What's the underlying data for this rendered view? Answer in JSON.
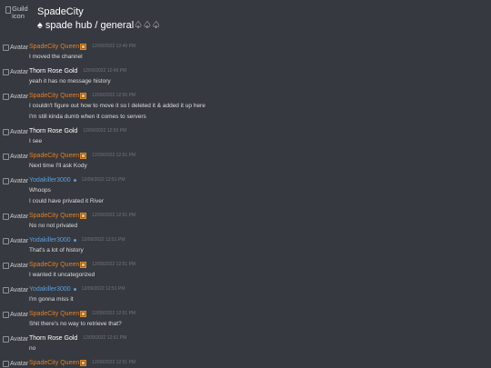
{
  "header": {
    "guild_icon_alt": "Guild icon",
    "guild_name": "SpadeCity",
    "channel_name": "♠ spade hub / general♤♤♤"
  },
  "colors": {
    "background": "#36393f",
    "queen": "#e67e22",
    "yodakiller": "#5b9fde",
    "thorn": "#ffffff"
  },
  "messages": [
    {
      "avatar_alt": "Avatar",
      "author": "SpadeCity Queen",
      "color": "#e67e22",
      "badge": "crown",
      "time": "12/09/2022 12:49 PM",
      "lines": [
        "I moved the channel"
      ]
    },
    {
      "avatar_alt": "Avatar",
      "author": "Thorn Rose Gold",
      "color": "#ffffff",
      "time": "12/09/2022 12:49 PM",
      "lines": [
        "yeah it has no message history"
      ]
    },
    {
      "avatar_alt": "Avatar",
      "author": "SpadeCity Queen",
      "color": "#e67e22",
      "badge": "crown",
      "time": "12/09/2022 12:50 PM",
      "lines": [
        "I couldn't figure out how to move it so I deleted it & added it up here",
        "I'm still kinda dumb when it comes to servers"
      ]
    },
    {
      "avatar_alt": "Avatar",
      "author": "Thorn Rose Gold",
      "color": "#ffffff",
      "time": "12/09/2022 12:50 PM",
      "lines": [
        "I see"
      ]
    },
    {
      "avatar_alt": "Avatar",
      "author": "SpadeCity Queen",
      "color": "#e67e22",
      "badge": "crown",
      "time": "12/09/2022 12:51 PM",
      "lines": [
        "Next time I'll ask Kody"
      ]
    },
    {
      "avatar_alt": "Avatar",
      "author": "Yodakiller3000",
      "color": "#5b9fde",
      "badge": "dot",
      "time": "12/09/2022 12:51 PM",
      "lines": [
        "Whoops",
        "I could have privated it River"
      ]
    },
    {
      "avatar_alt": "Avatar",
      "author": "SpadeCity Queen",
      "color": "#e67e22",
      "badge": "crown",
      "time": "12/09/2022 12:51 PM",
      "lines": [
        "No no not privated"
      ]
    },
    {
      "avatar_alt": "Avatar",
      "author": "Yodakiller3000",
      "color": "#5b9fde",
      "badge": "dot",
      "time": "12/09/2022 12:51 PM",
      "lines": [
        "That's a lot of history"
      ]
    },
    {
      "avatar_alt": "Avatar",
      "author": "SpadeCity Queen",
      "color": "#e67e22",
      "badge": "crown",
      "time": "12/09/2022 12:51 PM",
      "lines": [
        "I wanted it uncategorized"
      ]
    },
    {
      "avatar_alt": "Avatar",
      "author": "Yodakiller3000",
      "color": "#5b9fde",
      "badge": "dot",
      "time": "12/09/2022 12:51 PM",
      "lines": [
        "I'm gonna miss it"
      ]
    },
    {
      "avatar_alt": "Avatar",
      "author": "SpadeCity Queen",
      "color": "#e67e22",
      "badge": "crown",
      "time": "12/09/2022 12:51 PM",
      "lines": [
        "Shit there's no way to retrieve that?"
      ]
    },
    {
      "avatar_alt": "Avatar",
      "author": "Thorn Rose Gold",
      "color": "#ffffff",
      "time": "12/09/2022 12:51 PM",
      "lines": [
        "no"
      ]
    },
    {
      "avatar_alt": "Avatar",
      "author": "SpadeCity Queen",
      "color": "#e67e22",
      "badge": "crown",
      "time": "12/09/2022 12:51 PM",
      "lines": []
    }
  ]
}
